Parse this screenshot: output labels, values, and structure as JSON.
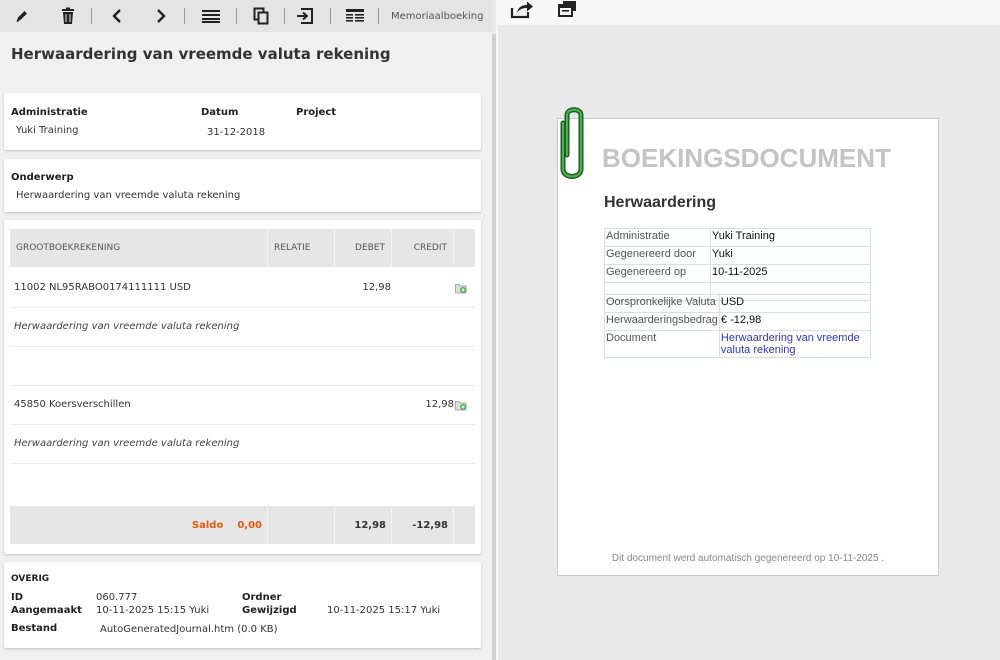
{
  "toolbar": {
    "icons": [
      "pencil-icon",
      "trash-icon",
      "chevron-left-icon",
      "chevron-right-icon",
      "menu-icon",
      "copy-icon",
      "import-icon",
      "list-view-icon"
    ],
    "label": "Memoriaalboeking"
  },
  "title": "Herwaardering van vreemde valuta rekening",
  "header_card": {
    "administratie_label": "Administratie",
    "administratie_value": "Yuki Training",
    "datum_label": "Datum",
    "datum_value": "31-12-2018",
    "project_label": "Project"
  },
  "subject_card": {
    "label": "Onderwerp",
    "value": "Herwaardering van vreemde valuta rekening"
  },
  "journal_table": {
    "columns": [
      "GROOTBOEKREKENING",
      "RELATIE",
      "DEBET",
      "CREDIT"
    ],
    "rows": [
      {
        "account": "11002 NL95RABO0174111111 USD",
        "debet": "12,98",
        "credit": "",
        "description": "Herwaardering van vreemde valuta rekening"
      },
      {
        "account": "45850 Koersverschillen",
        "debet": "",
        "credit": "12,98",
        "description": "Herwaardering van vreemde valuta rekening"
      }
    ],
    "footer": {
      "saldo_label": "Saldo",
      "saldo_value": "0,00",
      "debet_total": "12,98",
      "credit_total": "-12,98"
    },
    "colors": {
      "saldo": "#e8590c"
    }
  },
  "overig": {
    "heading": "OVERIG",
    "id_label": "ID",
    "id_value": "060.777",
    "ordner_label": "Ordner",
    "aangemaakt_label": "Aangemaakt",
    "aangemaakt_value": "10-11-2025 15:15 Yuki",
    "gewijzigd_label": "Gewijzigd",
    "gewijzigd_value": "10-11-2025 15:17 Yuki",
    "bestand_label": "Bestand",
    "bestand_value": "AutoGeneratedJournal.htm (0.0 KB)"
  },
  "preview": {
    "icons": [
      "share-icon",
      "open-window-icon"
    ],
    "doc_title": "BOEKINGSDOCUMENT",
    "doc_subtitle": "Herwaardering",
    "table1": [
      {
        "key": "Administratie",
        "value": "Yuki Training"
      },
      {
        "key": "Gegenereerd door",
        "value": "Yuki"
      },
      {
        "key": "Gegenereerd op",
        "value": "10-11-2025"
      }
    ],
    "table2": [
      {
        "key": "Oorspronkelijke Valuta",
        "value": "USD"
      },
      {
        "key": "Herwaarderingsbedrag",
        "value": "€ -12,98"
      },
      {
        "key": "Document",
        "value": "Herwaardering van vreemde valuta rekening"
      }
    ],
    "footer": "Dit document werd automatisch gegenereerd op 10-11-2025 ."
  }
}
